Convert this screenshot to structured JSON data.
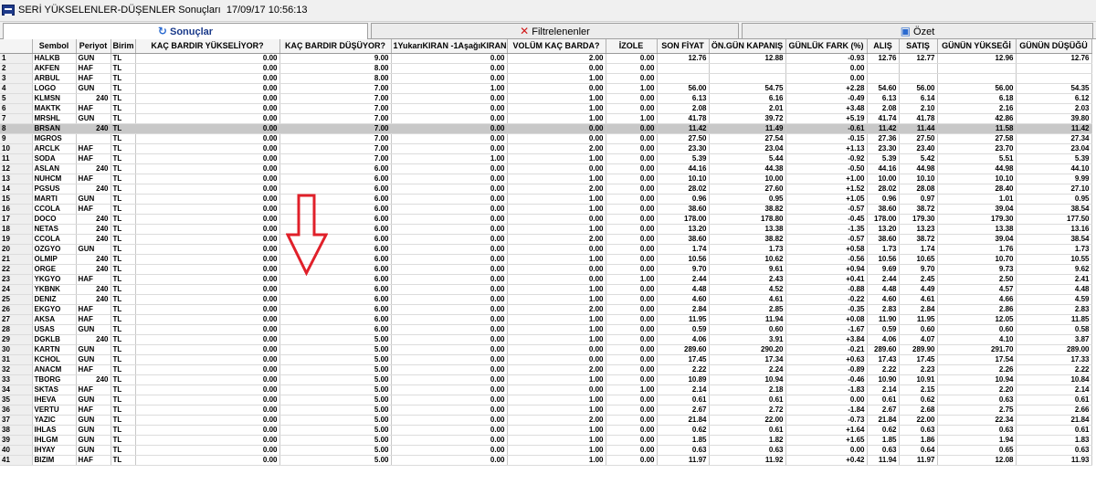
{
  "window": {
    "title": "SERİ YÜKSELENLER-DÜŞENLER Sonuçları",
    "timestamp": "17/09/17 10:56:13"
  },
  "tabs": [
    {
      "label": "Sonuçlar",
      "icon": "refresh-icon"
    },
    {
      "label": "Filtrelenenler",
      "icon": "x-icon"
    },
    {
      "label": "Özet",
      "icon": "summary-icon"
    }
  ],
  "columns": [
    "",
    "Sembol",
    "Periyot",
    "Birim",
    "KAÇ BARDIR YÜKSELİYOR?",
    "KAÇ BARDIR DÜŞÜYOR?",
    "1YukarıKIRAN -1AşağıKIRAN",
    "VOLÜM KAÇ BARDA?",
    "İZOLE",
    "SON FİYAT",
    "ÖN.GÜN KAPANIŞ",
    "GÜNLÜK FARK (%)",
    "ALIŞ",
    "SATIŞ",
    "GÜNÜN YÜKSEĞİ",
    "GÜNÜN DÜŞÜĞÜ"
  ],
  "selected_row": 8,
  "annotation": {
    "color": "#e0202a",
    "icon": "down-arrow-icon"
  },
  "rows": [
    [
      "1",
      "HALKB",
      "GUN",
      "TL",
      "0.00",
      "9.00",
      "0.00",
      "2.00",
      "0.00",
      "12.76",
      "12.88",
      "-0.93",
      "12.76",
      "12.77",
      "12.96",
      "12.76"
    ],
    [
      "2",
      "AKFEN",
      "HAF",
      "TL",
      "0.00",
      "8.00",
      "0.00",
      "0.00",
      "0.00",
      "",
      "",
      "0.00",
      "",
      "",
      "",
      ""
    ],
    [
      "3",
      "ARBUL",
      "HAF",
      "TL",
      "0.00",
      "8.00",
      "0.00",
      "1.00",
      "0.00",
      "",
      "",
      "0.00",
      "",
      "",
      "",
      ""
    ],
    [
      "4",
      "LOGO",
      "GUN",
      "TL",
      "0.00",
      "7.00",
      "1.00",
      "0.00",
      "1.00",
      "56.00",
      "54.75",
      "+2.28",
      "54.60",
      "56.00",
      "56.00",
      "54.35"
    ],
    [
      "5",
      "KLMSN",
      "240",
      "TL",
      "0.00",
      "7.00",
      "0.00",
      "1.00",
      "0.00",
      "6.13",
      "6.16",
      "-0.49",
      "6.13",
      "6.14",
      "6.18",
      "6.12"
    ],
    [
      "6",
      "MAKTK",
      "HAF",
      "TL",
      "0.00",
      "7.00",
      "0.00",
      "1.00",
      "0.00",
      "2.08",
      "2.01",
      "+3.48",
      "2.08",
      "2.10",
      "2.16",
      "2.03"
    ],
    [
      "7",
      "MRSHL",
      "GUN",
      "TL",
      "0.00",
      "7.00",
      "0.00",
      "1.00",
      "1.00",
      "41.78",
      "39.72",
      "+5.19",
      "41.74",
      "41.78",
      "42.86",
      "39.80"
    ],
    [
      "8",
      "BRSAN",
      "240",
      "TL",
      "0.00",
      "7.00",
      "0.00",
      "0.00",
      "0.00",
      "11.42",
      "11.49",
      "-0.61",
      "11.42",
      "11.44",
      "11.58",
      "11.42"
    ],
    [
      "9",
      "MGROS",
      "",
      "TL",
      "0.00",
      "7.00",
      "0.00",
      "0.00",
      "0.00",
      "27.50",
      "27.54",
      "-0.15",
      "27.36",
      "27.50",
      "27.58",
      "27.34"
    ],
    [
      "10",
      "ARCLK",
      "HAF",
      "TL",
      "0.00",
      "7.00",
      "0.00",
      "2.00",
      "0.00",
      "23.30",
      "23.04",
      "+1.13",
      "23.30",
      "23.40",
      "23.70",
      "23.04"
    ],
    [
      "11",
      "SODA",
      "HAF",
      "TL",
      "0.00",
      "7.00",
      "1.00",
      "1.00",
      "0.00",
      "5.39",
      "5.44",
      "-0.92",
      "5.39",
      "5.42",
      "5.51",
      "5.39"
    ],
    [
      "12",
      "ASLAN",
      "240",
      "TL",
      "0.00",
      "6.00",
      "0.00",
      "0.00",
      "0.00",
      "44.16",
      "44.38",
      "-0.50",
      "44.16",
      "44.98",
      "44.98",
      "44.10"
    ],
    [
      "13",
      "NUHCM",
      "HAF",
      "TL",
      "0.00",
      "6.00",
      "0.00",
      "1.00",
      "0.00",
      "10.10",
      "10.00",
      "+1.00",
      "10.00",
      "10.10",
      "10.10",
      "9.99"
    ],
    [
      "14",
      "PGSUS",
      "240",
      "TL",
      "0.00",
      "6.00",
      "0.00",
      "2.00",
      "0.00",
      "28.02",
      "27.60",
      "+1.52",
      "28.02",
      "28.08",
      "28.40",
      "27.10"
    ],
    [
      "15",
      "MARTI",
      "GUN",
      "TL",
      "0.00",
      "6.00",
      "0.00",
      "1.00",
      "0.00",
      "0.96",
      "0.95",
      "+1.05",
      "0.96",
      "0.97",
      "1.01",
      "0.95"
    ],
    [
      "16",
      "CCOLA",
      "HAF",
      "TL",
      "0.00",
      "6.00",
      "0.00",
      "1.00",
      "0.00",
      "38.60",
      "38.82",
      "-0.57",
      "38.60",
      "38.72",
      "39.04",
      "38.54"
    ],
    [
      "17",
      "DOCO",
      "240",
      "TL",
      "0.00",
      "6.00",
      "0.00",
      "0.00",
      "0.00",
      "178.00",
      "178.80",
      "-0.45",
      "178.00",
      "179.30",
      "179.30",
      "177.50"
    ],
    [
      "18",
      "NETAS",
      "240",
      "TL",
      "0.00",
      "6.00",
      "0.00",
      "1.00",
      "0.00",
      "13.20",
      "13.38",
      "-1.35",
      "13.20",
      "13.23",
      "13.38",
      "13.16"
    ],
    [
      "19",
      "CCOLA",
      "240",
      "TL",
      "0.00",
      "6.00",
      "0.00",
      "2.00",
      "0.00",
      "38.60",
      "38.82",
      "-0.57",
      "38.60",
      "38.72",
      "39.04",
      "38.54"
    ],
    [
      "20",
      "OZGYO",
      "GUN",
      "TL",
      "0.00",
      "6.00",
      "0.00",
      "0.00",
      "0.00",
      "1.74",
      "1.73",
      "+0.58",
      "1.73",
      "1.74",
      "1.76",
      "1.73"
    ],
    [
      "21",
      "OLMIP",
      "240",
      "TL",
      "0.00",
      "6.00",
      "0.00",
      "1.00",
      "0.00",
      "10.56",
      "10.62",
      "-0.56",
      "10.56",
      "10.65",
      "10.70",
      "10.55"
    ],
    [
      "22",
      "ORGE",
      "240",
      "TL",
      "0.00",
      "6.00",
      "0.00",
      "0.00",
      "0.00",
      "9.70",
      "9.61",
      "+0.94",
      "9.69",
      "9.70",
      "9.73",
      "9.62"
    ],
    [
      "23",
      "YKGYO",
      "HAF",
      "TL",
      "0.00",
      "6.00",
      "0.00",
      "0.00",
      "1.00",
      "2.44",
      "2.43",
      "+0.41",
      "2.44",
      "2.45",
      "2.50",
      "2.41"
    ],
    [
      "24",
      "YKBNK",
      "240",
      "TL",
      "0.00",
      "6.00",
      "0.00",
      "1.00",
      "0.00",
      "4.48",
      "4.52",
      "-0.88",
      "4.48",
      "4.49",
      "4.57",
      "4.48"
    ],
    [
      "25",
      "DENIZ",
      "240",
      "TL",
      "0.00",
      "6.00",
      "0.00",
      "1.00",
      "0.00",
      "4.60",
      "4.61",
      "-0.22",
      "4.60",
      "4.61",
      "4.66",
      "4.59"
    ],
    [
      "26",
      "EKGYO",
      "HAF",
      "TL",
      "0.00",
      "6.00",
      "0.00",
      "2.00",
      "0.00",
      "2.84",
      "2.85",
      "-0.35",
      "2.83",
      "2.84",
      "2.86",
      "2.83"
    ],
    [
      "27",
      "AKSA",
      "HAF",
      "TL",
      "0.00",
      "6.00",
      "0.00",
      "1.00",
      "0.00",
      "11.95",
      "11.94",
      "+0.08",
      "11.90",
      "11.95",
      "12.05",
      "11.85"
    ],
    [
      "28",
      "USAS",
      "GUN",
      "TL",
      "0.00",
      "6.00",
      "0.00",
      "1.00",
      "0.00",
      "0.59",
      "0.60",
      "-1.67",
      "0.59",
      "0.60",
      "0.60",
      "0.58"
    ],
    [
      "29",
      "DGKLB",
      "240",
      "TL",
      "0.00",
      "5.00",
      "0.00",
      "1.00",
      "0.00",
      "4.06",
      "3.91",
      "+3.84",
      "4.06",
      "4.07",
      "4.10",
      "3.87"
    ],
    [
      "30",
      "KARTN",
      "GUN",
      "TL",
      "0.00",
      "5.00",
      "0.00",
      "0.00",
      "0.00",
      "289.60",
      "290.20",
      "-0.21",
      "289.60",
      "289.90",
      "291.70",
      "289.00"
    ],
    [
      "31",
      "KCHOL",
      "GUN",
      "TL",
      "0.00",
      "5.00",
      "0.00",
      "0.00",
      "0.00",
      "17.45",
      "17.34",
      "+0.63",
      "17.43",
      "17.45",
      "17.54",
      "17.33"
    ],
    [
      "32",
      "ANACM",
      "HAF",
      "TL",
      "0.00",
      "5.00",
      "0.00",
      "2.00",
      "0.00",
      "2.22",
      "2.24",
      "-0.89",
      "2.22",
      "2.23",
      "2.26",
      "2.22"
    ],
    [
      "33",
      "TBORG",
      "240",
      "TL",
      "0.00",
      "5.00",
      "0.00",
      "1.00",
      "0.00",
      "10.89",
      "10.94",
      "-0.46",
      "10.90",
      "10.91",
      "10.94",
      "10.84"
    ],
    [
      "34",
      "SKTAS",
      "HAF",
      "TL",
      "0.00",
      "5.00",
      "0.00",
      "0.00",
      "1.00",
      "2.14",
      "2.18",
      "-1.83",
      "2.14",
      "2.15",
      "2.20",
      "2.14"
    ],
    [
      "35",
      "IHEVA",
      "GUN",
      "TL",
      "0.00",
      "5.00",
      "0.00",
      "1.00",
      "0.00",
      "0.61",
      "0.61",
      "0.00",
      "0.61",
      "0.62",
      "0.63",
      "0.61"
    ],
    [
      "36",
      "VERTU",
      "HAF",
      "TL",
      "0.00",
      "5.00",
      "0.00",
      "1.00",
      "0.00",
      "2.67",
      "2.72",
      "-1.84",
      "2.67",
      "2.68",
      "2.75",
      "2.66"
    ],
    [
      "37",
      "YAZIC",
      "GUN",
      "TL",
      "0.00",
      "5.00",
      "0.00",
      "2.00",
      "0.00",
      "21.84",
      "22.00",
      "-0.73",
      "21.84",
      "22.00",
      "22.34",
      "21.84"
    ],
    [
      "38",
      "IHLAS",
      "GUN",
      "TL",
      "0.00",
      "5.00",
      "0.00",
      "1.00",
      "0.00",
      "0.62",
      "0.61",
      "+1.64",
      "0.62",
      "0.63",
      "0.63",
      "0.61"
    ],
    [
      "39",
      "IHLGM",
      "GUN",
      "TL",
      "0.00",
      "5.00",
      "0.00",
      "1.00",
      "0.00",
      "1.85",
      "1.82",
      "+1.65",
      "1.85",
      "1.86",
      "1.94",
      "1.83"
    ],
    [
      "40",
      "IHYAY",
      "GUN",
      "TL",
      "0.00",
      "5.00",
      "0.00",
      "1.00",
      "0.00",
      "0.63",
      "0.63",
      "0.00",
      "0.63",
      "0.64",
      "0.65",
      "0.63"
    ],
    [
      "41",
      "BIZIM",
      "HAF",
      "TL",
      "0.00",
      "5.00",
      "0.00",
      "1.00",
      "0.00",
      "11.97",
      "11.92",
      "+0.42",
      "11.94",
      "11.97",
      "12.08",
      "11.93"
    ]
  ]
}
